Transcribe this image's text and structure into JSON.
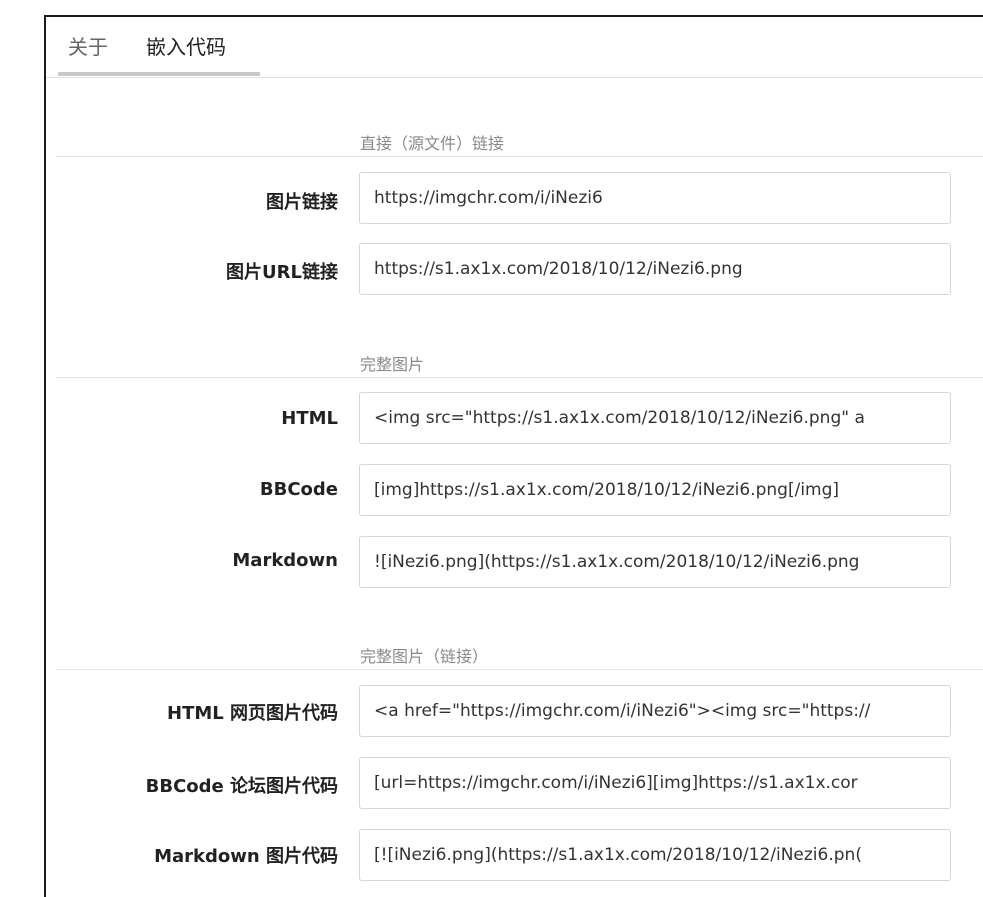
{
  "tabs": {
    "about": "关于",
    "embed": "嵌入代码"
  },
  "sections": [
    {
      "title": "直接（源文件）链接",
      "rows": [
        {
          "label": "图片链接",
          "value": "https://imgchr.com/i/iNezi6"
        },
        {
          "label": "图片URL链接",
          "value": "https://s1.ax1x.com/2018/10/12/iNezi6.png"
        }
      ]
    },
    {
      "title": "完整图片",
      "rows": [
        {
          "label": "HTML",
          "value": "<img src=\"https://s1.ax1x.com/2018/10/12/iNezi6.png\" a"
        },
        {
          "label": "BBCode",
          "value": "[img]https://s1.ax1x.com/2018/10/12/iNezi6.png[/img]"
        },
        {
          "label": "Markdown",
          "value": "![iNezi6.png](https://s1.ax1x.com/2018/10/12/iNezi6.png"
        }
      ]
    },
    {
      "title": "完整图片（链接）",
      "rows": [
        {
          "label": "HTML 网页图片代码",
          "value": "<a href=\"https://imgchr.com/i/iNezi6\"><img src=\"https://"
        },
        {
          "label": "BBCode 论坛图片代码",
          "value": "[url=https://imgchr.com/i/iNezi6][img]https://s1.ax1x.cor"
        },
        {
          "label": "Markdown 图片代码",
          "value": "[![iNezi6.png](https://s1.ax1x.com/2018/10/12/iNezi6.pn("
        }
      ]
    }
  ]
}
